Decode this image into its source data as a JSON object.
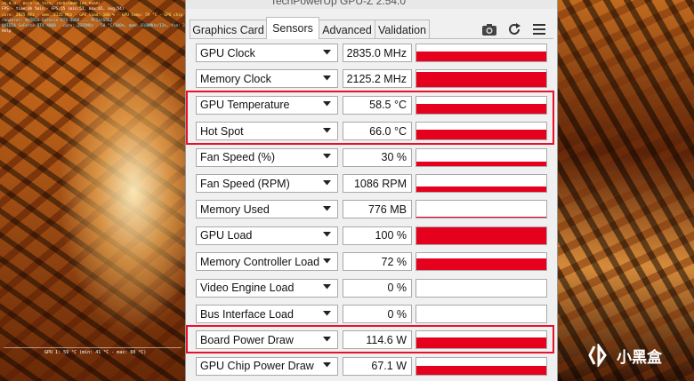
{
  "window": {
    "title": "TechPowerUp GPU-Z 2.54.0"
  },
  "overlay": {
    "lines": [
      "26.0.0 - Burn-in test, 1920x1080 (8X MSAA)",
      "FPS - time:0h 5min - FPS:55 (min:51, max:65, avg:54)",
      "core: 2835 MHz - mem: 2125 MHz - GPU load: 100 % - GPU temp: 59 °C - GPU chip power: 67",
      "renderer: NVIDIA GeForce RTX 4060 ... PCIe/SSE2",
      "NVIDIA GeForce RTX 4060 - core: 2835MHz - 58 °C/100%, mem: 8188MHz/13%, fan: 30%, limits(",
      "Help"
    ],
    "graph_label": "GPU 1: 59 °C (min: 41 °C - max: 60 °C)"
  },
  "tabs": [
    {
      "label": "Graphics Card",
      "active": false
    },
    {
      "label": "Sensors",
      "active": true
    },
    {
      "label": "Advanced",
      "active": false
    },
    {
      "label": "Validation",
      "active": false
    }
  ],
  "toolbar": {
    "camera_icon": "camera-icon",
    "refresh_icon": "refresh-icon",
    "menu_icon": "menu-icon"
  },
  "sensors": [
    {
      "label": "GPU Clock",
      "value": "2835.0 MHz",
      "fill": 0.6,
      "highlight": false
    },
    {
      "label": "Memory Clock",
      "value": "2125.2 MHz",
      "fill": 0.9,
      "highlight": false
    },
    {
      "label": "GPU Temperature",
      "value": "58.5 °C",
      "fill": 0.55,
      "highlight": true
    },
    {
      "label": "Hot Spot",
      "value": "66.0 °C",
      "fill": 0.6,
      "highlight": true
    },
    {
      "label": "Fan Speed (%)",
      "value": "30 %",
      "fill": 0.25,
      "highlight": false
    },
    {
      "label": "Fan Speed (RPM)",
      "value": "1086 RPM",
      "fill": 0.3,
      "highlight": false
    },
    {
      "label": "Memory Used",
      "value": "776 MB",
      "fill": 0.1,
      "highlight": false
    },
    {
      "label": "GPU Load",
      "value": "100 %",
      "fill": 1.0,
      "highlight": false
    },
    {
      "label": "Memory Controller Load",
      "value": "72 %",
      "fill": 0.72,
      "highlight": false
    },
    {
      "label": "Video Engine Load",
      "value": "0 %",
      "fill": 0.0,
      "highlight": false
    },
    {
      "label": "Bus Interface Load",
      "value": "0 %",
      "fill": 0.0,
      "highlight": false
    },
    {
      "label": "Board Power Draw",
      "value": "114.6 W",
      "fill": 0.65,
      "highlight": true
    },
    {
      "label": "GPU Chip Power Draw",
      "value": "67.1 W",
      "fill": 0.5,
      "highlight": false
    }
  ],
  "watermark": {
    "text": "小黑盒"
  },
  "colors": {
    "graph": "#e5001e",
    "highlight": "#e8102a"
  }
}
